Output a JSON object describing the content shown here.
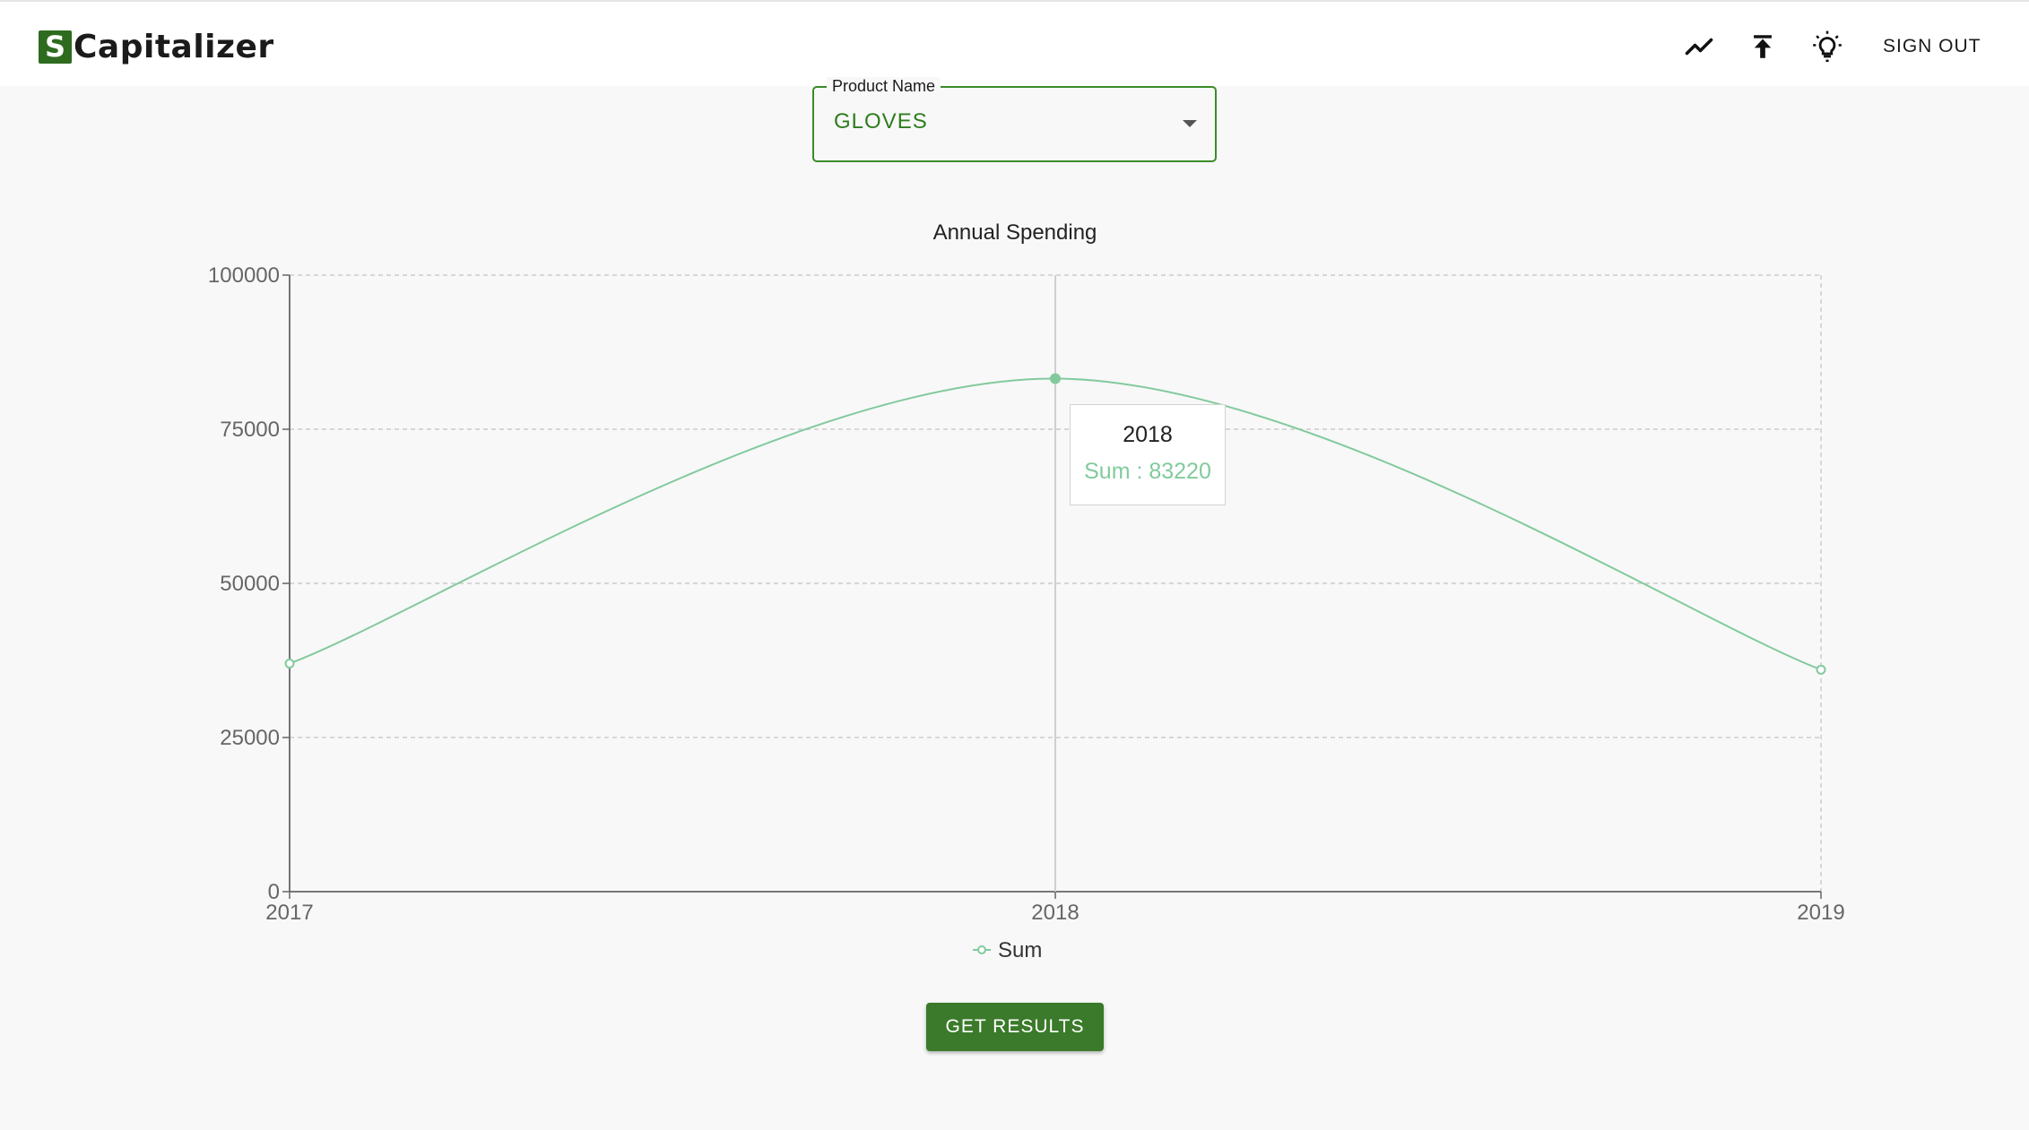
{
  "header": {
    "logo_mark": "S",
    "logo_text": "Capitalizer",
    "signout_label": "SIGN OUT"
  },
  "product_field": {
    "label": "Product Name",
    "value": "GLOVES"
  },
  "chart_data": {
    "type": "line",
    "title": "Annual Spending",
    "x": [
      "2017",
      "2018",
      "2019"
    ],
    "series": [
      {
        "name": "Sum",
        "values": [
          37000,
          83220,
          36000
        ],
        "color": "#82ca9d"
      }
    ],
    "ylim": [
      0,
      100000
    ],
    "yticks": [
      "0",
      "25000",
      "50000",
      "75000",
      "100000"
    ],
    "grid": true,
    "legend": "bottom-center",
    "tooltip": {
      "x": "2018",
      "label": "Sum : 83220"
    }
  },
  "actions": {
    "get_results_label": "GET RESULTS"
  }
}
